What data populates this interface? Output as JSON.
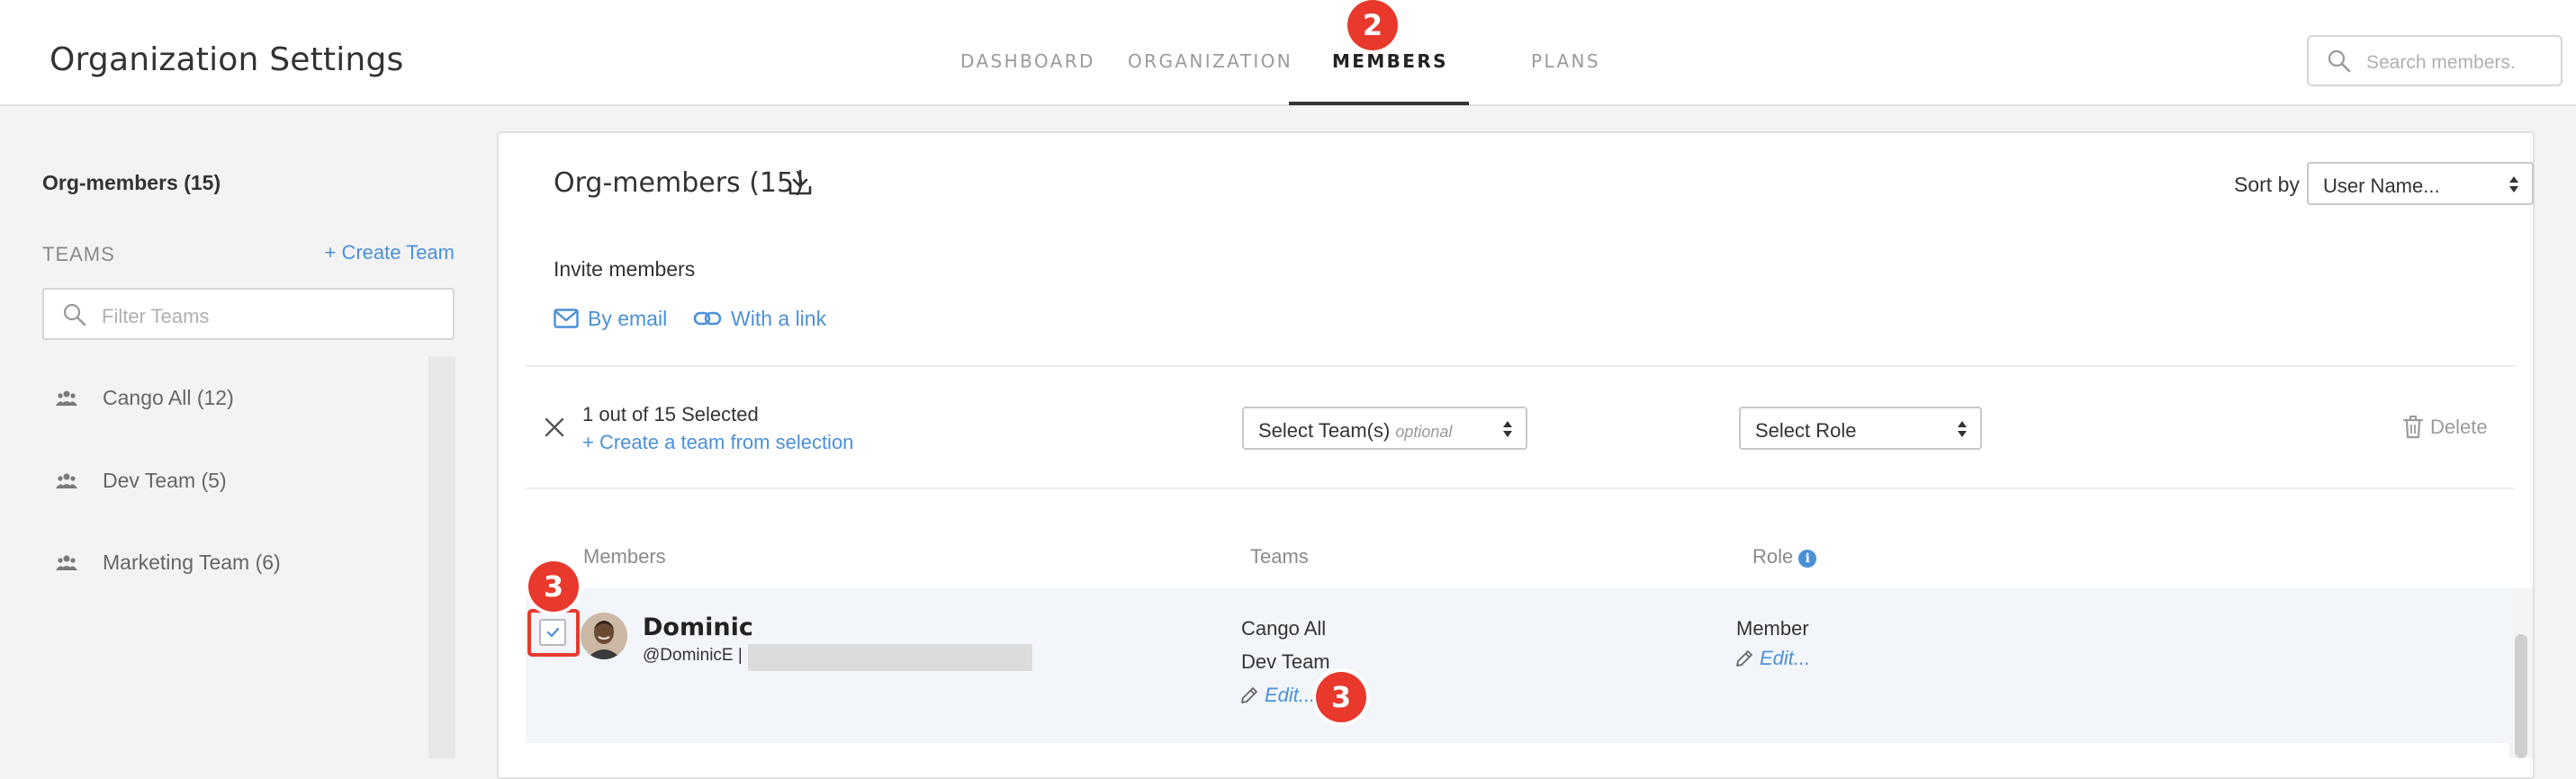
{
  "header": {
    "title": "Organization Settings",
    "tabs": [
      {
        "label": "DASHBOARD"
      },
      {
        "label": "ORGANIZATION"
      },
      {
        "label": "MEMBERS"
      },
      {
        "label": "PLANS"
      }
    ],
    "search_placeholder": "Search members."
  },
  "callouts": {
    "tab": "2",
    "checkbox": "3",
    "edit": "3"
  },
  "sidebar": {
    "title": "Org-members (15)",
    "teams_label": "TEAMS",
    "create_team": "+ Create Team",
    "filter_placeholder": "Filter Teams",
    "teams": [
      {
        "label": "Cango All (12)"
      },
      {
        "label": "Dev Team (5)"
      },
      {
        "label": "Marketing Team (6)"
      }
    ]
  },
  "main": {
    "title": "Org-members (15)",
    "sort_label": "Sort by",
    "sort_value": "User Name...",
    "invite_title": "Invite members",
    "invite_email": "By email",
    "invite_link": "With a link",
    "selection": {
      "count": "1 out of 15 Selected",
      "create_from": "+ Create a team from selection",
      "team_select": "Select Team(s)",
      "team_select_optional": "optional",
      "role_select": "Select Role",
      "delete": "Delete"
    },
    "columns": {
      "members": "Members",
      "teams": "Teams",
      "role": "Role",
      "role_info": "i"
    },
    "rows": [
      {
        "name": "Dominic",
        "handle": "@DominicE |",
        "teams": [
          "Cango All",
          "Dev Team"
        ],
        "teams_edit": "Edit...",
        "role": "Member",
        "role_edit": "Edit..."
      }
    ]
  },
  "colors": {
    "accent": "#4a90d9",
    "callout": "#e8392c"
  }
}
